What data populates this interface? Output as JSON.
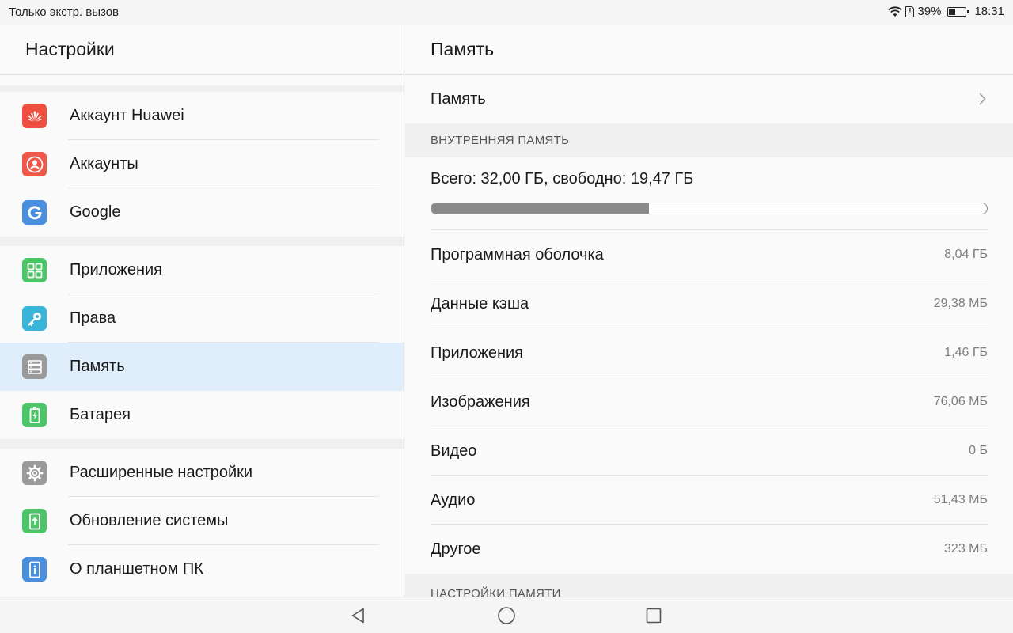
{
  "status_bar": {
    "carrier": "Только экстр. вызов",
    "battery": "39%",
    "time": "18:31"
  },
  "left": {
    "title": "Настройки",
    "groups": [
      [
        {
          "label": "Аккаунт Huawei",
          "icon": "huawei-icon",
          "color": "#ee4f3f"
        },
        {
          "label": "Аккаунты",
          "icon": "account-icon",
          "color": "#f0584b"
        },
        {
          "label": "Google",
          "icon": "google-icon",
          "color": "#4a8fdd"
        }
      ],
      [
        {
          "label": "Приложения",
          "icon": "apps-icon",
          "color": "#4cc569"
        },
        {
          "label": "Права",
          "icon": "key-icon",
          "color": "#3ab4d9"
        },
        {
          "label": "Память",
          "icon": "storage-icon",
          "color": "#9a9a9a",
          "active": true
        },
        {
          "label": "Батарея",
          "icon": "battery-icon",
          "color": "#4cc569"
        }
      ],
      [
        {
          "label": "Расширенные настройки",
          "icon": "gear-icon",
          "color": "#9a9a9a"
        },
        {
          "label": "Обновление системы",
          "icon": "system-update-icon",
          "color": "#4cc569"
        },
        {
          "label": "О планшетном ПК",
          "icon": "info-icon",
          "color": "#4a8fdd"
        }
      ]
    ]
  },
  "right": {
    "title": "Память",
    "storage_link": "Память",
    "internal_section": "ВНУТРЕННЯЯ ПАМЯТЬ",
    "total_text": "Всего: 32,00 ГБ, свободно: 19,47 ГБ",
    "used_fraction": 0.392,
    "rows": [
      {
        "name": "Программная оболочка",
        "value": "8,04 ГБ"
      },
      {
        "name": "Данные кэша",
        "value": "29,38 МБ"
      },
      {
        "name": "Приложения",
        "value": "1,46 ГБ"
      },
      {
        "name": "Изображения",
        "value": "76,06 МБ"
      },
      {
        "name": "Видео",
        "value": "0 Б"
      },
      {
        "name": "Аудио",
        "value": "51,43 МБ"
      },
      {
        "name": "Другое",
        "value": "323 МБ"
      }
    ],
    "settings_section": "НАСТРОЙКИ ПАМЯТИ"
  },
  "colors": {
    "active_bg": "#e0eefb",
    "bar_used": "#8a8a8a"
  }
}
